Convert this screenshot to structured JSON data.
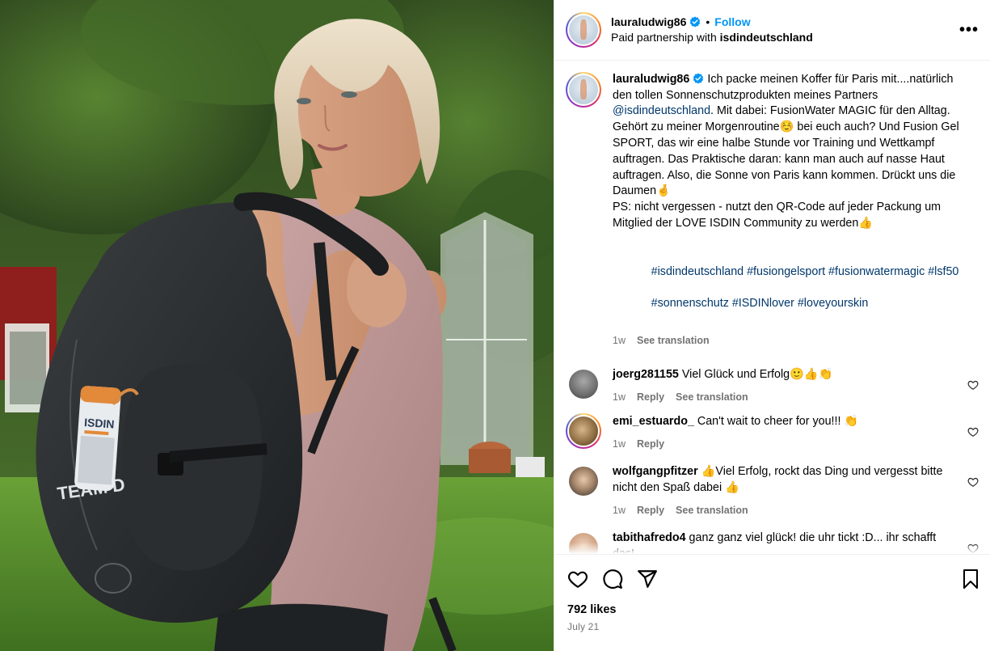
{
  "post": {
    "username": "lauraludwig86",
    "follow_label": "Follow",
    "partner_prefix": "Paid partnership with",
    "partner_name": "isdindeutschland",
    "more_label": "•••",
    "separator": "•"
  },
  "caption": {
    "username": "lauraludwig86",
    "text_1": "Ich packe meinen Koffer für Paris mit....natürlich den tollen Sonnenschutzprodukten meines Partners ",
    "mention": "@isdindeutschland",
    "text_2": ". Mit dabei: FusionWater MAGIC für den Alltag. Gehört zu meiner Morgenroutine☺️ bei euch auch? Und Fusion Gel SPORT, das wir eine halbe Stunde vor Training und Wettkampf auftragen. Das Praktische daran: kann man auch auf nasse Haut auftragen. Also, die Sonne von Paris kann kommen. Drückt uns die Daumen🤞\nPS: nicht vergessen - nutzt den QR-Code auf jeder Packung um Mitglied der LOVE ISDIN Community zu werden👍",
    "hashtags_line1": "#isdindeutschland #fusiongelsport #fusionwatermagic #lsf50",
    "hashtags_line2": "#sonnenschutz #ISDINlover #loveyourskin",
    "time": "1w",
    "see_translation": "See translation"
  },
  "comments": [
    {
      "username": "joerg281155",
      "text": "Viel Glück und Erfolg🙂👍👏",
      "time": "1w",
      "reply": "Reply",
      "see_translation": "See translation"
    },
    {
      "username": "emi_estuardo_",
      "text": "Can't wait to cheer for you!!! 👏",
      "time": "1w",
      "reply": "Reply"
    },
    {
      "username": "wolfgangpfitzer",
      "text": "👍Viel Erfolg, rockt das Ding und vergesst bitte nicht den Spaß dabei 👍",
      "time": "1w",
      "reply": "Reply",
      "see_translation": "See translation"
    },
    {
      "username": "tabithafredo4",
      "text": "ganz ganz viel glück! die uhr tickt :D... ihr schafft das!"
    }
  ],
  "footer": {
    "likes": "792 likes",
    "date": "July 21"
  },
  "photo": {
    "product_brand": "ISDIN",
    "bag_text": "TEAM D"
  },
  "colors": {
    "accent": "#0095f6",
    "link": "#00376b",
    "muted": "#737373"
  }
}
